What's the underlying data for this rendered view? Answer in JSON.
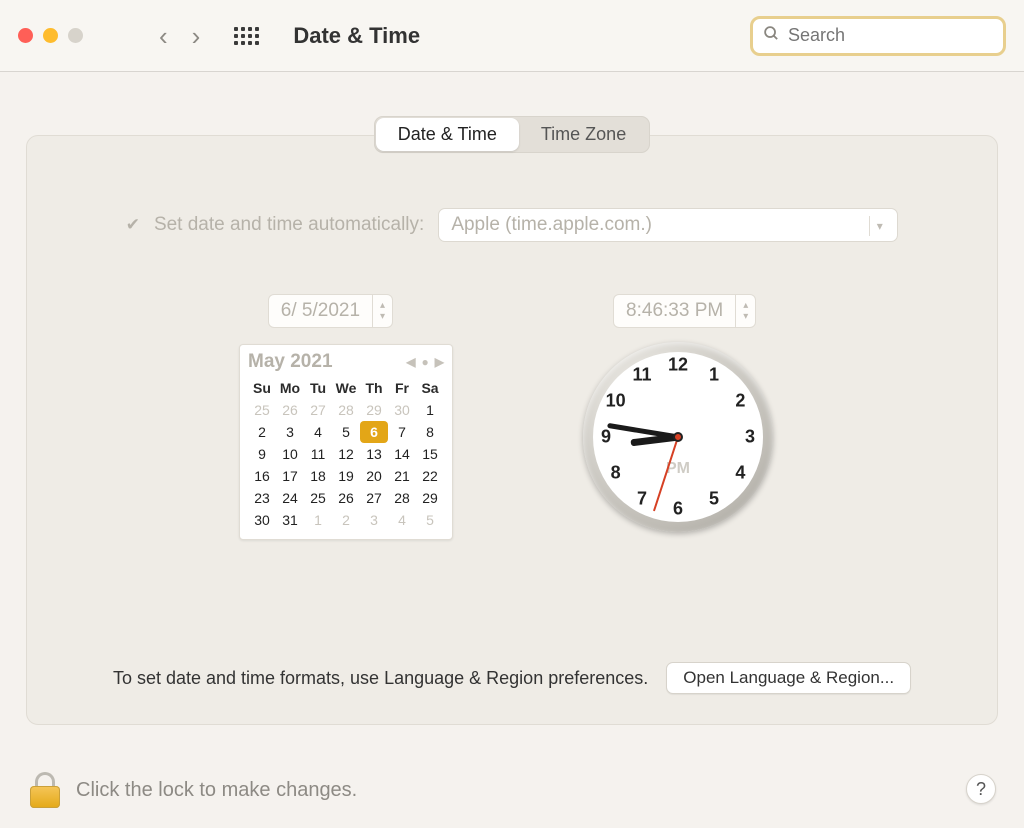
{
  "window": {
    "title": "Date & Time"
  },
  "search": {
    "placeholder": "Search"
  },
  "tabs": {
    "date_time": "Date & Time",
    "time_zone": "Time Zone",
    "active": "date_time"
  },
  "auto": {
    "label": "Set date and time automatically:",
    "checked": true,
    "server": "Apple (time.apple.com.)"
  },
  "date_field": "6/ 5/2021",
  "time_field": "8:46:33 PM",
  "calendar": {
    "title": "May 2021",
    "weekdays": [
      "Su",
      "Mo",
      "Tu",
      "We",
      "Th",
      "Fr",
      "Sa"
    ],
    "weeks": [
      [
        {
          "n": 25,
          "out": true
        },
        {
          "n": 26,
          "out": true
        },
        {
          "n": 27,
          "out": true
        },
        {
          "n": 28,
          "out": true
        },
        {
          "n": 29,
          "out": true
        },
        {
          "n": 30,
          "out": true
        },
        {
          "n": 1
        }
      ],
      [
        {
          "n": 2
        },
        {
          "n": 3
        },
        {
          "n": 4
        },
        {
          "n": 5
        },
        {
          "n": 6,
          "sel": true
        },
        {
          "n": 7
        },
        {
          "n": 8
        }
      ],
      [
        {
          "n": 9
        },
        {
          "n": 10
        },
        {
          "n": 11
        },
        {
          "n": 12
        },
        {
          "n": 13
        },
        {
          "n": 14
        },
        {
          "n": 15
        }
      ],
      [
        {
          "n": 16
        },
        {
          "n": 17
        },
        {
          "n": 18
        },
        {
          "n": 19
        },
        {
          "n": 20
        },
        {
          "n": 21
        },
        {
          "n": 22
        }
      ],
      [
        {
          "n": 23
        },
        {
          "n": 24
        },
        {
          "n": 25
        },
        {
          "n": 26
        },
        {
          "n": 27
        },
        {
          "n": 28
        },
        {
          "n": 29
        }
      ],
      [
        {
          "n": 30
        },
        {
          "n": 31
        },
        {
          "n": 1,
          "out": true
        },
        {
          "n": 2,
          "out": true
        },
        {
          "n": 3,
          "out": true
        },
        {
          "n": 4,
          "out": true
        },
        {
          "n": 5,
          "out": true
        }
      ]
    ]
  },
  "clock": {
    "numbers": [
      "12",
      "1",
      "2",
      "3",
      "4",
      "5",
      "6",
      "7",
      "8",
      "9",
      "10",
      "11"
    ],
    "ampm": "PM",
    "time": {
      "h": 8,
      "m": 46,
      "s": 33
    }
  },
  "hint": "To set date and time formats, use Language & Region preferences.",
  "open_button": "Open Language & Region...",
  "lock_label": "Click the lock to make changes.",
  "help": "?"
}
